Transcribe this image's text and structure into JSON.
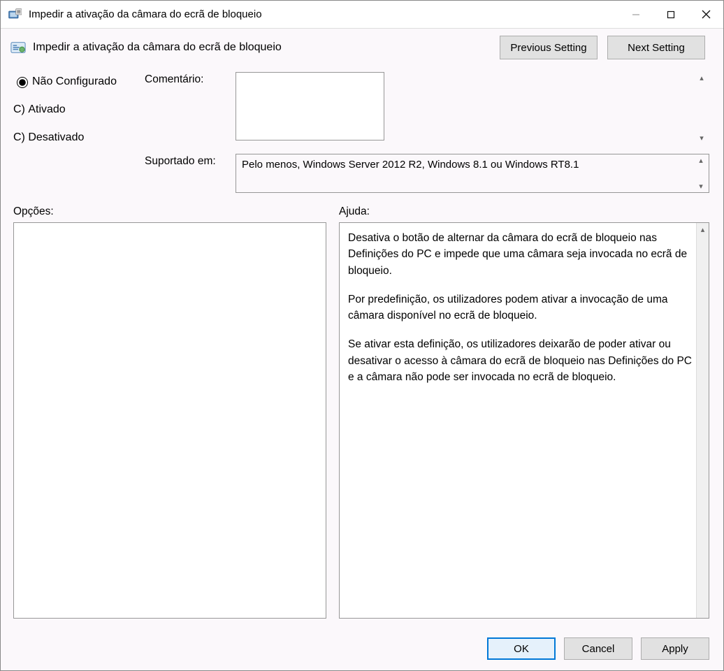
{
  "window": {
    "title": "Impedir a ativação da câmara do ecrã de bloqueio"
  },
  "header": {
    "policy_title": "Impedir a ativação da câmara do ecrã de bloqueio",
    "previous_setting": "Previous Setting",
    "next_setting": "Next Setting"
  },
  "radios": {
    "not_configured": "Não Configurado",
    "enabled": "Ativado",
    "disabled": "Desativado",
    "selected": "not_configured"
  },
  "fields": {
    "comment_label": "Comentário:",
    "comment_value": "",
    "supported_label": "Suportado em:",
    "supported_value": "Pelo menos, Windows Server 2012 R2, Windows 8.1 ou Windows RT8.1"
  },
  "labels": {
    "options": "Opções:",
    "help": "Ajuda:"
  },
  "help": {
    "p1": "Desativa o botão de alternar da câmara do ecrã de bloqueio nas Definições do PC e impede que uma câmara seja invocada no ecrã de bloqueio.",
    "p2": "Por predefinição, os utilizadores podem ativar a invocação de uma câmara disponível no ecrã de bloqueio.",
    "p3": "Se ativar esta definição, os utilizadores deixarão de poder ativar ou desativar o acesso à câmara do ecrã de bloqueio nas Definições do PC e a câmara não pode ser invocada no ecrã de bloqueio."
  },
  "footer": {
    "ok": "OK",
    "cancel": "Cancel",
    "apply": "Apply"
  }
}
